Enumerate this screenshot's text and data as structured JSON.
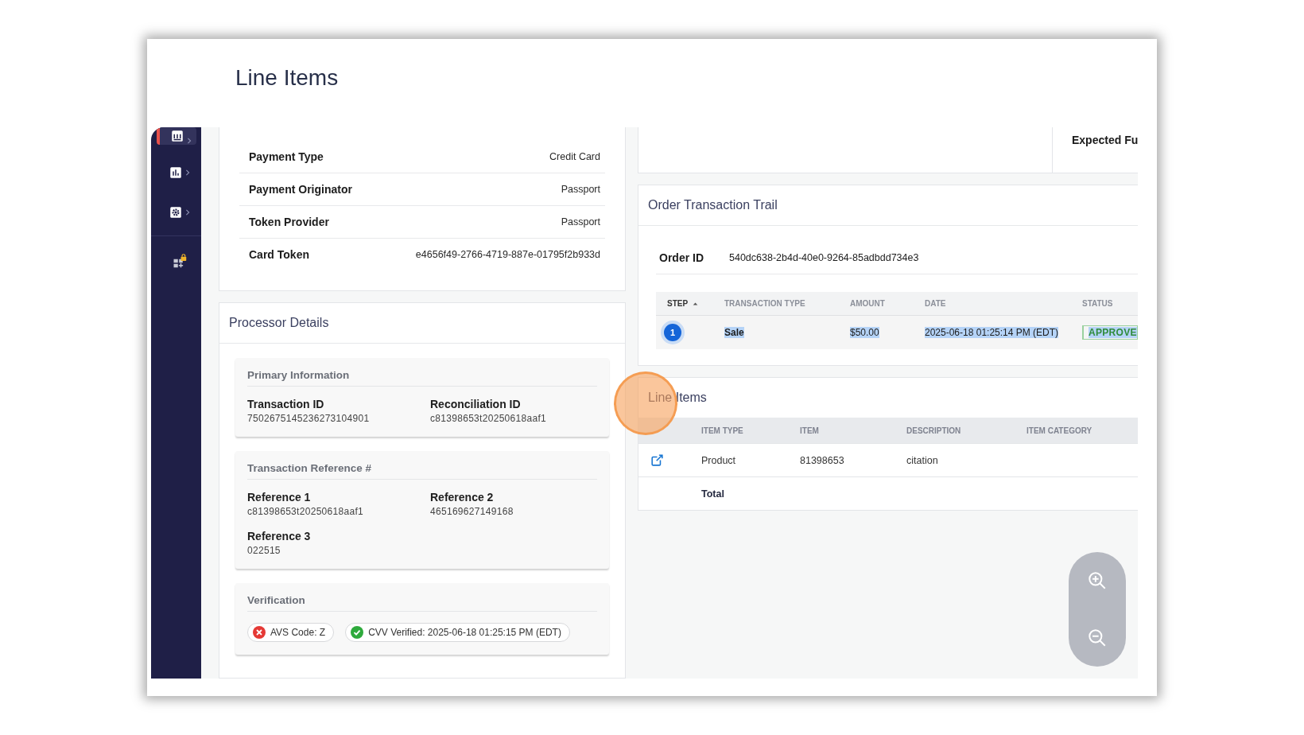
{
  "page_title": "Line Items",
  "sidebar": {
    "items": [
      {
        "selected": true,
        "expandable": true
      },
      {
        "selected": false,
        "expandable": true
      },
      {
        "selected": false,
        "expandable": true
      },
      {
        "selected": false,
        "expandable": false
      }
    ]
  },
  "payment_details": [
    {
      "label": "Payment Type",
      "value": "Credit Card"
    },
    {
      "label": "Payment Originator",
      "value": "Passport"
    },
    {
      "label": "Token Provider",
      "value": "Passport"
    },
    {
      "label": "Card Token",
      "value": "e4656f49-2766-4719-887e-01795f2b933d"
    }
  ],
  "processor_details": {
    "title": "Processor Details",
    "sections": [
      {
        "title": "Primary Information",
        "fields": [
          {
            "label": "Transaction ID",
            "value": "7502675145236273104901"
          },
          {
            "label": "Reconciliation ID",
            "value": "c81398653t20250618aaf1"
          }
        ]
      },
      {
        "title": "Transaction Reference #",
        "fields": [
          {
            "label": "Reference 1",
            "value": "c81398653t20250618aaf1"
          },
          {
            "label": "Reference 2",
            "value": "465169627149168"
          },
          {
            "label": "Reference 3",
            "value": "022515"
          }
        ]
      },
      {
        "title": "Verification",
        "chips": [
          {
            "label": "AVS Code: Z",
            "passed": false
          },
          {
            "label": "CVV Verified: 2025-06-18 01:25:15 PM (EDT)",
            "passed": true
          }
        ]
      }
    ]
  },
  "summary_card": {
    "column_2_label": "Expected Fu"
  },
  "order_transaction_trail": {
    "title": "Order Transaction Trail",
    "order_id_label": "Order ID",
    "order_id": "540dc638-2b4d-40e0-9264-85adbdd734e3",
    "table": {
      "columns": [
        {
          "label": "STEP",
          "sorted": true
        },
        {
          "label": "TRANSACTION TYPE",
          "sorted": false
        },
        {
          "label": "AMOUNT",
          "sorted": false
        },
        {
          "label": "DATE",
          "sorted": false
        },
        {
          "label": "STATUS",
          "sorted": false
        }
      ],
      "rows": [
        {
          "step": "1",
          "transaction_type": "Sale",
          "amount": "$50.00",
          "date": "2025-06-18 01:25:14 PM (EDT)",
          "status": "APPROVE",
          "highlighted": true
        }
      ]
    }
  },
  "line_items": {
    "title": "Line Items",
    "columns": [
      "ITEM TYPE",
      "ITEM",
      "DESCRIPTION",
      "ITEM CATEGORY"
    ],
    "rows": [
      {
        "kind": "item",
        "item_type": "Product",
        "item": "81398653",
        "description": "citation"
      },
      {
        "kind": "total",
        "label": "Total"
      }
    ]
  },
  "click_marker": {
    "shown": true
  }
}
